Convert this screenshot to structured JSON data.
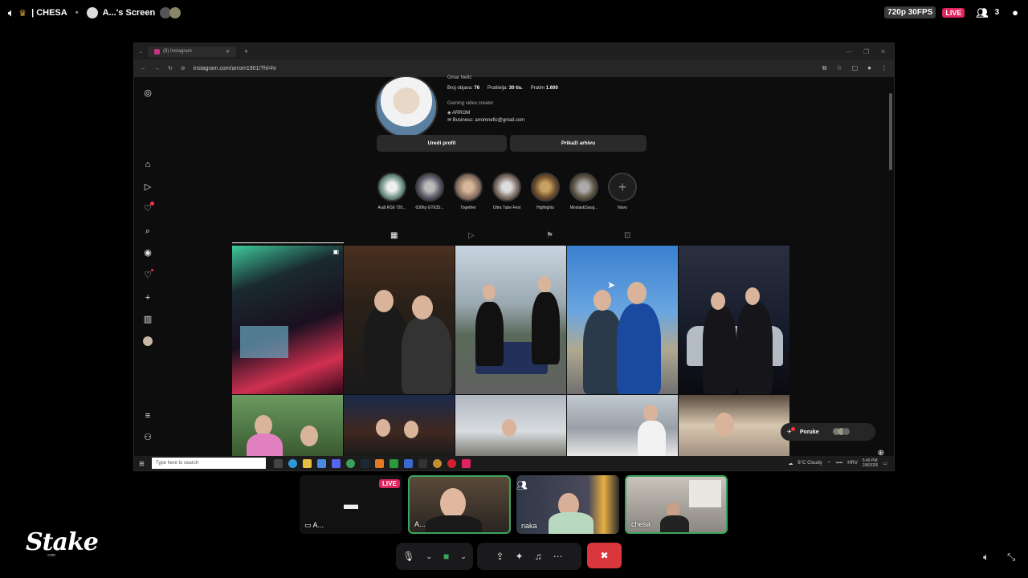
{
  "topbar": {
    "server": "| CHESA",
    "screen_title": "A...'s Screen",
    "quality": "720p 30FPS",
    "live": "LIVE",
    "viewers": "3"
  },
  "browser": {
    "tab_title": "(9) Instagram",
    "url": "instagram.com/arrom1901/?hl=hr"
  },
  "profile": {
    "name": "Omar Nefić",
    "stats": [
      {
        "label": "Broj objava:",
        "value": "76"
      },
      {
        "label": "Pratitelja:",
        "value": "30 tis."
      },
      {
        "label": "Pratim",
        "value": "1.600"
      }
    ],
    "bio_category": "Gaming video creator",
    "bio_line1": "ARROM",
    "bio_line2": "Business: arromnefic@gmail.com",
    "edit_button": "Uredi profil",
    "archive_button": "Prikaži arhivu"
  },
  "highlights": [
    {
      "label": "Audi RS6 720..."
    },
    {
      "label": "630hp GT63S..."
    },
    {
      "label": "Together"
    },
    {
      "label": "Ultra Tube Fest"
    },
    {
      "label": "Highlights"
    },
    {
      "label": "Mostar&Saraj..."
    },
    {
      "label": "Novo"
    }
  ],
  "messages_pill": {
    "label": "Poruke"
  },
  "taskbar": {
    "search_placeholder": "Type here to search",
    "weather": "6°C  Cloudy",
    "lang": "HRV",
    "time": "5:49 PM",
    "date": "2/8/2026"
  },
  "participants": [
    {
      "name": "A..."
    },
    {
      "name": "A..."
    },
    {
      "name": "naka"
    },
    {
      "name": "chesa"
    }
  ],
  "participant_live": "LIVE",
  "brand": {
    "logo": "Stake",
    "sub": ".com"
  },
  "icons": [
    "instagram-icon",
    "home-icon",
    "reels-icon",
    "notifications-icon",
    "search-icon",
    "explore-icon",
    "heart-icon",
    "create-icon",
    "insights-icon",
    "menu-icon",
    "threads-icon",
    "mic-icon",
    "camera-icon",
    "screenshare-icon",
    "activities-icon",
    "soundboard-icon",
    "more-icon",
    "leave-icon"
  ],
  "colors": {
    "live": "#e0245e",
    "speaking": "#3ba55d",
    "leave": "#da373c",
    "notif": "#ff3040"
  }
}
